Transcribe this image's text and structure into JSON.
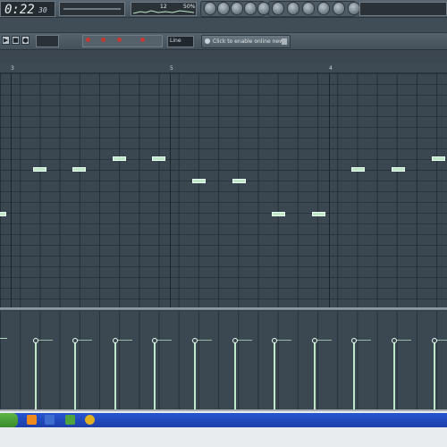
{
  "toolbar": {
    "time_main": "0:22",
    "time_sub": "30",
    "meter_value": "12",
    "cpu_text": "50%"
  },
  "toolbar2": {
    "snap_value": "Line",
    "news_text": "Click to enable online news"
  },
  "ruler": {
    "marks": [
      "3",
      "5",
      "4"
    ]
  },
  "colors": {
    "grid_bg": "#3a4750",
    "note": "#bfe8c9",
    "taskbar_blue": "#2755d1",
    "start_green": "#5fb548"
  },
  "notes": [
    {
      "col": 0,
      "row": 12
    },
    {
      "col": 1,
      "row": 8
    },
    {
      "col": 2,
      "row": 8
    },
    {
      "col": 3,
      "row": 7
    },
    {
      "col": 4,
      "row": 7
    },
    {
      "col": 5,
      "row": 9
    },
    {
      "col": 6,
      "row": 9
    },
    {
      "col": 7,
      "row": 12
    },
    {
      "col": 8,
      "row": 12
    },
    {
      "col": 9,
      "row": 8
    },
    {
      "col": 10,
      "row": 8
    },
    {
      "col": 11,
      "row": 7
    }
  ],
  "velocity_level": 0.8,
  "icons": [
    "tool-icon-1",
    "tool-icon-2",
    "tool-icon-3",
    "tool-icon-4",
    "tool-icon-5",
    "tool-icon-6",
    "tool-icon-7",
    "tool-icon-8",
    "tool-icon-9",
    "tool-icon-10",
    "tool-icon-11"
  ]
}
